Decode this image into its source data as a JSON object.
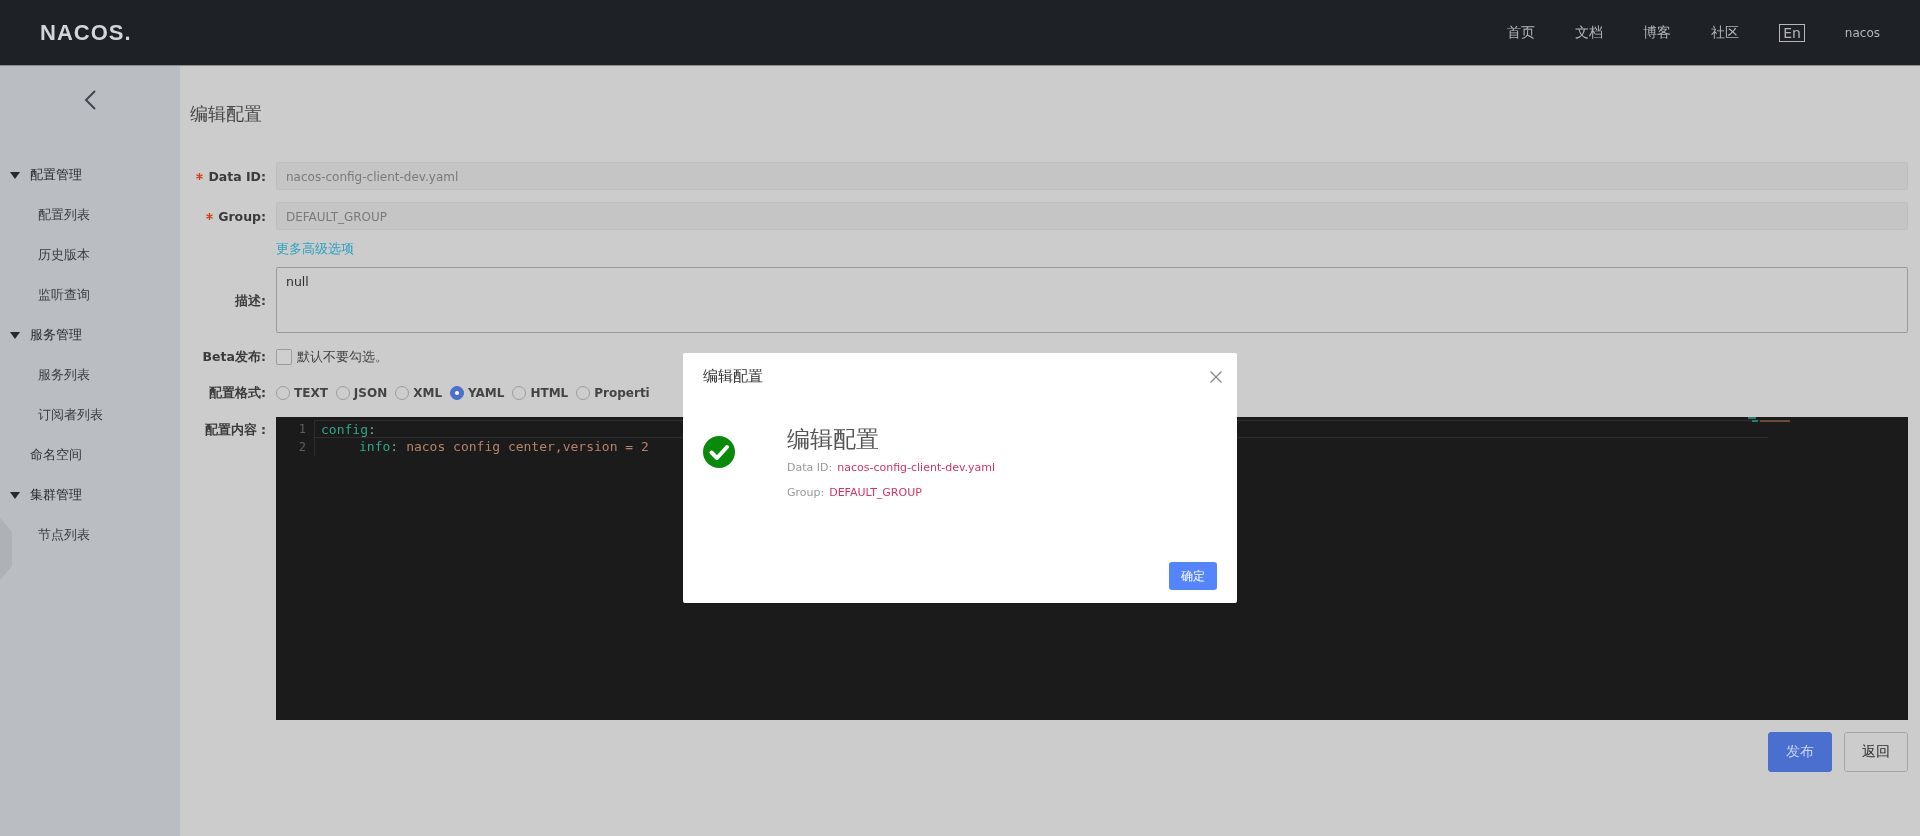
{
  "header": {
    "logo": "NACOS.",
    "nav": [
      "首页",
      "文档",
      "博客",
      "社区"
    ],
    "language": "En",
    "user": "nacos"
  },
  "sidebar": {
    "items": [
      {
        "label": "配置管理",
        "expanded": true,
        "selected": false,
        "children": [
          {
            "label": "配置列表",
            "selected": false
          },
          {
            "label": "历史版本",
            "selected": false
          },
          {
            "label": "监听查询",
            "selected": false
          }
        ]
      },
      {
        "label": "服务管理",
        "expanded": true,
        "selected": false,
        "children": [
          {
            "label": "服务列表",
            "selected": false
          },
          {
            "label": "订阅者列表",
            "selected": false
          }
        ]
      },
      {
        "label": "命名空间",
        "selected": false
      },
      {
        "label": "集群管理",
        "expanded": true,
        "selected": false,
        "children": [
          {
            "label": "节点列表",
            "selected": false
          }
        ]
      }
    ]
  },
  "form": {
    "title": "编辑配置",
    "data_id": {
      "label": "Data ID:",
      "required": true,
      "value": "nacos-config-client-dev.yaml"
    },
    "group": {
      "label": "Group:",
      "required": true,
      "value": "DEFAULT_GROUP"
    },
    "advanced_link": "更多高级选项",
    "description": {
      "label": "描述:",
      "value": "null"
    },
    "beta": {
      "label": "Beta发布:",
      "checked": false,
      "text": "默认不要勾选。"
    },
    "format": {
      "label": "配置格式:",
      "options": [
        {
          "label": "TEXT",
          "selected": false
        },
        {
          "label": "JSON",
          "selected": false
        },
        {
          "label": "XML",
          "selected": false
        },
        {
          "label": "YAML",
          "selected": true
        },
        {
          "label": "HTML",
          "selected": false
        },
        {
          "label": "Properti",
          "selected": false
        }
      ]
    },
    "content": {
      "label": "配置内容",
      "colon": ":",
      "lines": [
        {
          "number": "1",
          "key": "config",
          "colon": ":",
          "children": [
            {
              "number": "2",
              "key": "info",
              "colon": ":",
              "value": "nacos config center,version = 2"
            }
          ]
        }
      ]
    },
    "buttons": [
      {
        "label": "发布",
        "kind": "primary"
      },
      {
        "label": "返回",
        "kind": "normal"
      }
    ]
  },
  "dialog": {
    "title": "编辑配置",
    "heading": "编辑配置",
    "details": [
      {
        "label": "Data ID:",
        "value": "nacos-config-client-dev.yaml"
      },
      {
        "label": "Group:",
        "value": "DEFAULT_GROUP"
      }
    ],
    "ok": "确定"
  }
}
